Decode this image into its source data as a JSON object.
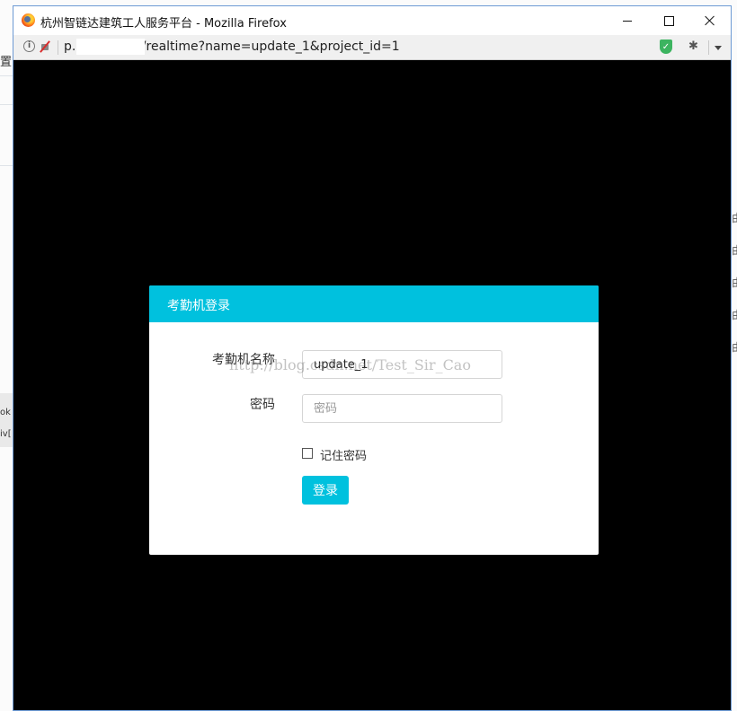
{
  "background_page": {
    "tab_fragment": "置",
    "right_fragments": [
      "由",
      "由",
      "由",
      "由",
      "由"
    ],
    "left_fragments": [
      "ok",
      "iv["
    ]
  },
  "window": {
    "title": "杭州智链达建筑工人服务平台 - Mozilla Firefox",
    "url": "p.           data.cn/#/realtime?name=update_1&project_id=1",
    "icons": {
      "logo": "firefox-logo",
      "info": "info-icon",
      "mixed_content": "mixed-content-icon",
      "shield": "tracking-protection-shield-icon",
      "extension": "extension-icon",
      "menu": "chevron-down-icon",
      "minimize": "minimize-icon",
      "maximize": "maximize-icon",
      "close": "close-icon"
    },
    "info_glyph": "i",
    "shield_glyph": "✓",
    "extension_glyph": "✱"
  },
  "modal": {
    "title": "考勤机登录",
    "name_label": "考勤机名称",
    "name_value": "update_1",
    "password_label": "密码",
    "password_placeholder": "密码",
    "remember_label": "记住密码",
    "remember_checked": false,
    "login_button": "登录"
  },
  "watermark": "http://blog.csdn.net/Test_Sir_Cao",
  "colors": {
    "accent": "#00c1de",
    "backdrop": "#000000",
    "window_border": "#6d9ad4"
  }
}
